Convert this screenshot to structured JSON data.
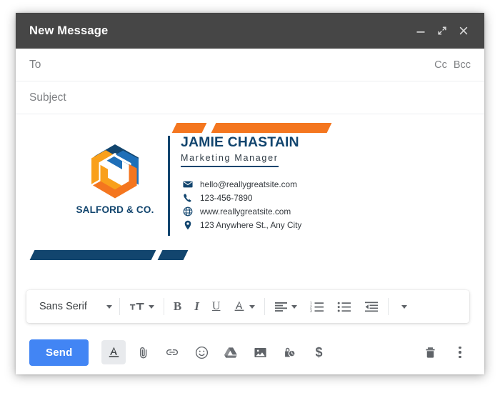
{
  "window": {
    "title": "New Message",
    "controls": [
      {
        "name": "minimize",
        "label": "Minimize"
      },
      {
        "name": "expand",
        "label": "Full screen"
      },
      {
        "name": "close",
        "label": "Close"
      }
    ]
  },
  "fields": {
    "to": {
      "placeholder": "To",
      "value": ""
    },
    "cc": "Cc",
    "bcc": "Bcc",
    "subject": {
      "placeholder": "Subject",
      "value": ""
    }
  },
  "signature": {
    "company": "SALFORD & CO.",
    "name": "JAMIE CHASTAIN",
    "role": "Marketing Manager",
    "contacts": [
      {
        "icon": "envelope-icon",
        "text": "hello@reallygreatsite.com"
      },
      {
        "icon": "phone-icon",
        "text": "123-456-7890"
      },
      {
        "icon": "globe-icon",
        "text": "www.reallygreatsite.com"
      },
      {
        "icon": "location-pin-icon",
        "text": "123 Anywhere St., Any City"
      }
    ],
    "colors": {
      "navy": "#12456e",
      "blue": "#1e6fb8",
      "orange": "#f4761f",
      "amber": "#f9a01b"
    }
  },
  "format_toolbar": {
    "font_family": "Sans Serif",
    "items": [
      {
        "name": "font-size",
        "label": "Font size"
      },
      {
        "name": "bold",
        "label": "B"
      },
      {
        "name": "italic",
        "label": "I"
      },
      {
        "name": "underline",
        "label": "U"
      },
      {
        "name": "text-color",
        "label": "A"
      },
      {
        "name": "align",
        "label": "Align"
      },
      {
        "name": "numbered-list",
        "label": "Numbered list"
      },
      {
        "name": "bulleted-list",
        "label": "Bulleted list"
      },
      {
        "name": "indent",
        "label": "Indent"
      },
      {
        "name": "more-format",
        "label": "More formatting options"
      }
    ]
  },
  "action_bar": {
    "send_label": "Send",
    "icons": [
      {
        "name": "formatting-options-icon",
        "label": "Formatting options",
        "active": true
      },
      {
        "name": "attach-file-icon",
        "label": "Attach files"
      },
      {
        "name": "insert-link-icon",
        "label": "Insert link"
      },
      {
        "name": "insert-emoji-icon",
        "label": "Insert emoji"
      },
      {
        "name": "google-drive-icon",
        "label": "Insert files using Drive"
      },
      {
        "name": "insert-photo-icon",
        "label": "Insert photo"
      },
      {
        "name": "confidential-mode-icon",
        "label": "Toggle confidential mode"
      },
      {
        "name": "insert-money-icon",
        "label": "Insert money"
      }
    ],
    "right_icons": [
      {
        "name": "discard-draft-icon",
        "label": "Discard draft"
      },
      {
        "name": "more-options-icon",
        "label": "More options"
      }
    ]
  },
  "theme": {
    "header_bg": "#464646",
    "send_blue": "#4285f4",
    "icon_gray": "#5f6368",
    "placeholder_gray": "#7f8184"
  }
}
